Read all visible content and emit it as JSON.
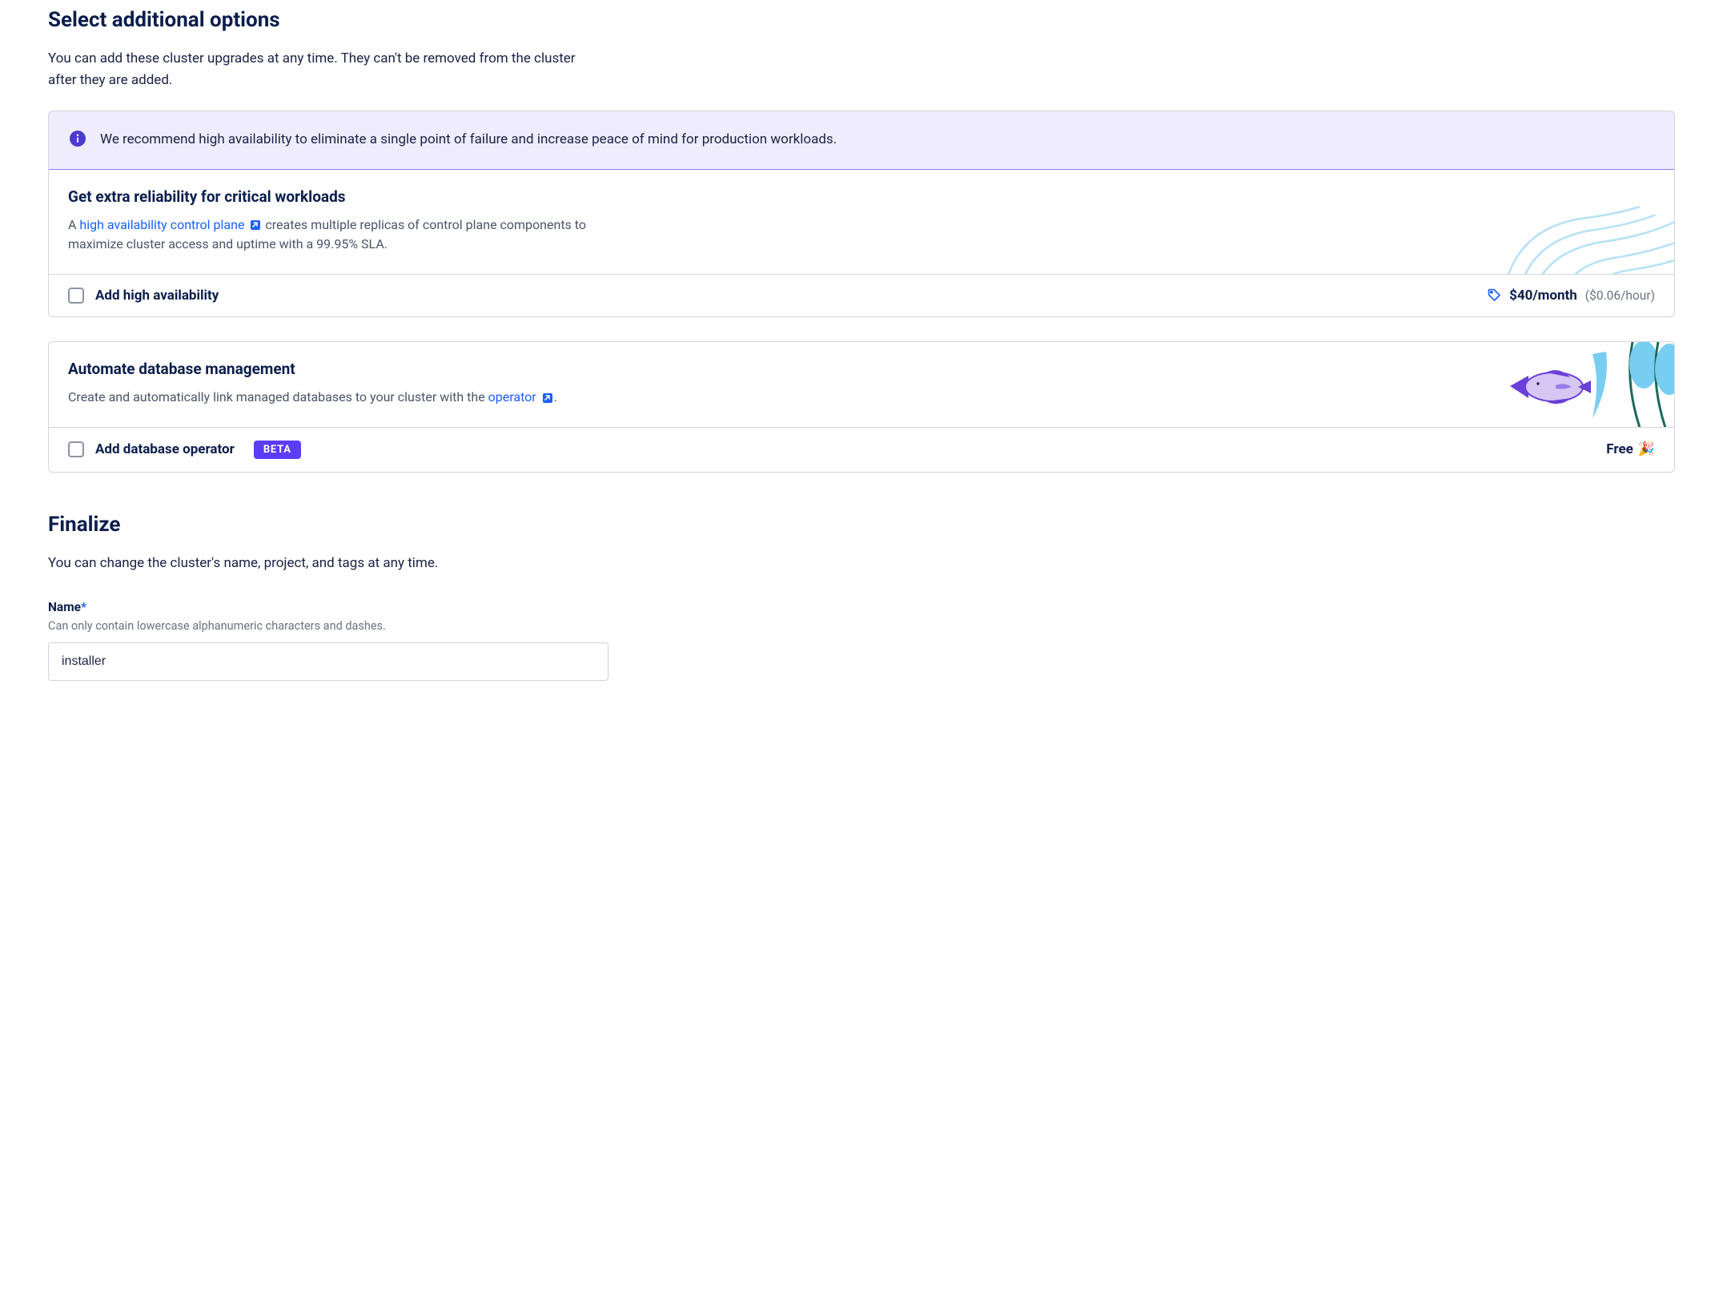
{
  "options": {
    "heading": "Select additional options",
    "description": "You can add these cluster upgrades at any time. They can't be removed from the cluster after they are added.",
    "banner": "We recommend high availability to eliminate a single point of failure and increase peace of mind for production workloads.",
    "ha": {
      "title": "Get extra reliability for critical workloads",
      "desc_prefix": "A ",
      "desc_link": "high availability control plane",
      "desc_suffix": " creates multiple replicas of control plane components to maximize cluster access and uptime with a 99.95% SLA.",
      "checkbox_label": "Add high availability",
      "price_main": "$40/month",
      "price_sub": "($0.06/hour)"
    },
    "db": {
      "title": "Automate database management",
      "desc_prefix": "Create and automatically link managed databases to your cluster with the ",
      "desc_link": "operator",
      "desc_suffix": ".",
      "checkbox_label": "Add database operator",
      "badge": "BETA",
      "price": "Free"
    }
  },
  "finalize": {
    "heading": "Finalize",
    "description": "You can change the cluster's name, project, and tags at any time.",
    "name_label": "Name",
    "name_required": "*",
    "name_hint": "Can only contain lowercase alphanumeric characters and dashes.",
    "name_value": "installer"
  },
  "colors": {
    "accent": "#5a3df5",
    "link": "#1a5fff"
  }
}
